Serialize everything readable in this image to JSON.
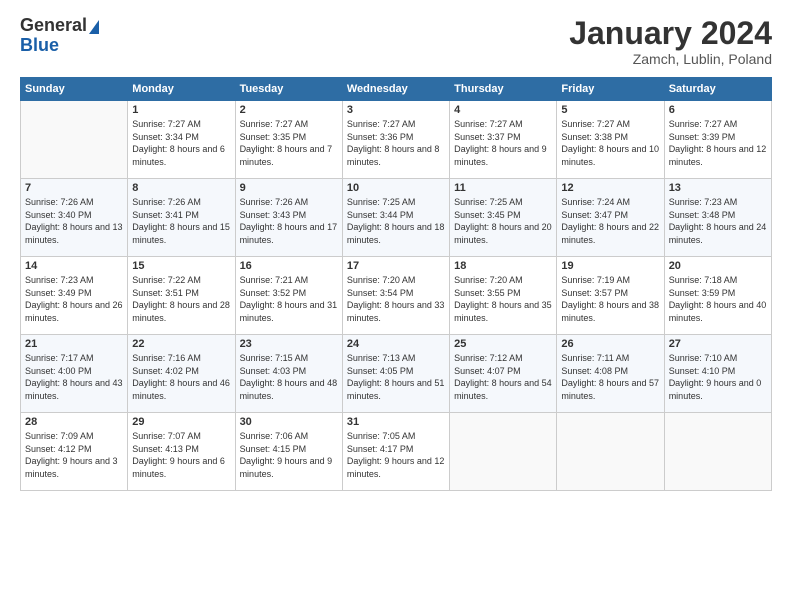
{
  "header": {
    "logo_general": "General",
    "logo_blue": "Blue",
    "title": "January 2024",
    "subtitle": "Zamch, Lublin, Poland"
  },
  "weekdays": [
    "Sunday",
    "Monday",
    "Tuesday",
    "Wednesday",
    "Thursday",
    "Friday",
    "Saturday"
  ],
  "weeks": [
    [
      {
        "num": "",
        "sunrise": "",
        "sunset": "",
        "daylight": ""
      },
      {
        "num": "1",
        "sunrise": "Sunrise: 7:27 AM",
        "sunset": "Sunset: 3:34 PM",
        "daylight": "Daylight: 8 hours and 6 minutes."
      },
      {
        "num": "2",
        "sunrise": "Sunrise: 7:27 AM",
        "sunset": "Sunset: 3:35 PM",
        "daylight": "Daylight: 8 hours and 7 minutes."
      },
      {
        "num": "3",
        "sunrise": "Sunrise: 7:27 AM",
        "sunset": "Sunset: 3:36 PM",
        "daylight": "Daylight: 8 hours and 8 minutes."
      },
      {
        "num": "4",
        "sunrise": "Sunrise: 7:27 AM",
        "sunset": "Sunset: 3:37 PM",
        "daylight": "Daylight: 8 hours and 9 minutes."
      },
      {
        "num": "5",
        "sunrise": "Sunrise: 7:27 AM",
        "sunset": "Sunset: 3:38 PM",
        "daylight": "Daylight: 8 hours and 10 minutes."
      },
      {
        "num": "6",
        "sunrise": "Sunrise: 7:27 AM",
        "sunset": "Sunset: 3:39 PM",
        "daylight": "Daylight: 8 hours and 12 minutes."
      }
    ],
    [
      {
        "num": "7",
        "sunrise": "Sunrise: 7:26 AM",
        "sunset": "Sunset: 3:40 PM",
        "daylight": "Daylight: 8 hours and 13 minutes."
      },
      {
        "num": "8",
        "sunrise": "Sunrise: 7:26 AM",
        "sunset": "Sunset: 3:41 PM",
        "daylight": "Daylight: 8 hours and 15 minutes."
      },
      {
        "num": "9",
        "sunrise": "Sunrise: 7:26 AM",
        "sunset": "Sunset: 3:43 PM",
        "daylight": "Daylight: 8 hours and 17 minutes."
      },
      {
        "num": "10",
        "sunrise": "Sunrise: 7:25 AM",
        "sunset": "Sunset: 3:44 PM",
        "daylight": "Daylight: 8 hours and 18 minutes."
      },
      {
        "num": "11",
        "sunrise": "Sunrise: 7:25 AM",
        "sunset": "Sunset: 3:45 PM",
        "daylight": "Daylight: 8 hours and 20 minutes."
      },
      {
        "num": "12",
        "sunrise": "Sunrise: 7:24 AM",
        "sunset": "Sunset: 3:47 PM",
        "daylight": "Daylight: 8 hours and 22 minutes."
      },
      {
        "num": "13",
        "sunrise": "Sunrise: 7:23 AM",
        "sunset": "Sunset: 3:48 PM",
        "daylight": "Daylight: 8 hours and 24 minutes."
      }
    ],
    [
      {
        "num": "14",
        "sunrise": "Sunrise: 7:23 AM",
        "sunset": "Sunset: 3:49 PM",
        "daylight": "Daylight: 8 hours and 26 minutes."
      },
      {
        "num": "15",
        "sunrise": "Sunrise: 7:22 AM",
        "sunset": "Sunset: 3:51 PM",
        "daylight": "Daylight: 8 hours and 28 minutes."
      },
      {
        "num": "16",
        "sunrise": "Sunrise: 7:21 AM",
        "sunset": "Sunset: 3:52 PM",
        "daylight": "Daylight: 8 hours and 31 minutes."
      },
      {
        "num": "17",
        "sunrise": "Sunrise: 7:20 AM",
        "sunset": "Sunset: 3:54 PM",
        "daylight": "Daylight: 8 hours and 33 minutes."
      },
      {
        "num": "18",
        "sunrise": "Sunrise: 7:20 AM",
        "sunset": "Sunset: 3:55 PM",
        "daylight": "Daylight: 8 hours and 35 minutes."
      },
      {
        "num": "19",
        "sunrise": "Sunrise: 7:19 AM",
        "sunset": "Sunset: 3:57 PM",
        "daylight": "Daylight: 8 hours and 38 minutes."
      },
      {
        "num": "20",
        "sunrise": "Sunrise: 7:18 AM",
        "sunset": "Sunset: 3:59 PM",
        "daylight": "Daylight: 8 hours and 40 minutes."
      }
    ],
    [
      {
        "num": "21",
        "sunrise": "Sunrise: 7:17 AM",
        "sunset": "Sunset: 4:00 PM",
        "daylight": "Daylight: 8 hours and 43 minutes."
      },
      {
        "num": "22",
        "sunrise": "Sunrise: 7:16 AM",
        "sunset": "Sunset: 4:02 PM",
        "daylight": "Daylight: 8 hours and 46 minutes."
      },
      {
        "num": "23",
        "sunrise": "Sunrise: 7:15 AM",
        "sunset": "Sunset: 4:03 PM",
        "daylight": "Daylight: 8 hours and 48 minutes."
      },
      {
        "num": "24",
        "sunrise": "Sunrise: 7:13 AM",
        "sunset": "Sunset: 4:05 PM",
        "daylight": "Daylight: 8 hours and 51 minutes."
      },
      {
        "num": "25",
        "sunrise": "Sunrise: 7:12 AM",
        "sunset": "Sunset: 4:07 PM",
        "daylight": "Daylight: 8 hours and 54 minutes."
      },
      {
        "num": "26",
        "sunrise": "Sunrise: 7:11 AM",
        "sunset": "Sunset: 4:08 PM",
        "daylight": "Daylight: 8 hours and 57 minutes."
      },
      {
        "num": "27",
        "sunrise": "Sunrise: 7:10 AM",
        "sunset": "Sunset: 4:10 PM",
        "daylight": "Daylight: 9 hours and 0 minutes."
      }
    ],
    [
      {
        "num": "28",
        "sunrise": "Sunrise: 7:09 AM",
        "sunset": "Sunset: 4:12 PM",
        "daylight": "Daylight: 9 hours and 3 minutes."
      },
      {
        "num": "29",
        "sunrise": "Sunrise: 7:07 AM",
        "sunset": "Sunset: 4:13 PM",
        "daylight": "Daylight: 9 hours and 6 minutes."
      },
      {
        "num": "30",
        "sunrise": "Sunrise: 7:06 AM",
        "sunset": "Sunset: 4:15 PM",
        "daylight": "Daylight: 9 hours and 9 minutes."
      },
      {
        "num": "31",
        "sunrise": "Sunrise: 7:05 AM",
        "sunset": "Sunset: 4:17 PM",
        "daylight": "Daylight: 9 hours and 12 minutes."
      },
      {
        "num": "",
        "sunrise": "",
        "sunset": "",
        "daylight": ""
      },
      {
        "num": "",
        "sunrise": "",
        "sunset": "",
        "daylight": ""
      },
      {
        "num": "",
        "sunrise": "",
        "sunset": "",
        "daylight": ""
      }
    ]
  ]
}
